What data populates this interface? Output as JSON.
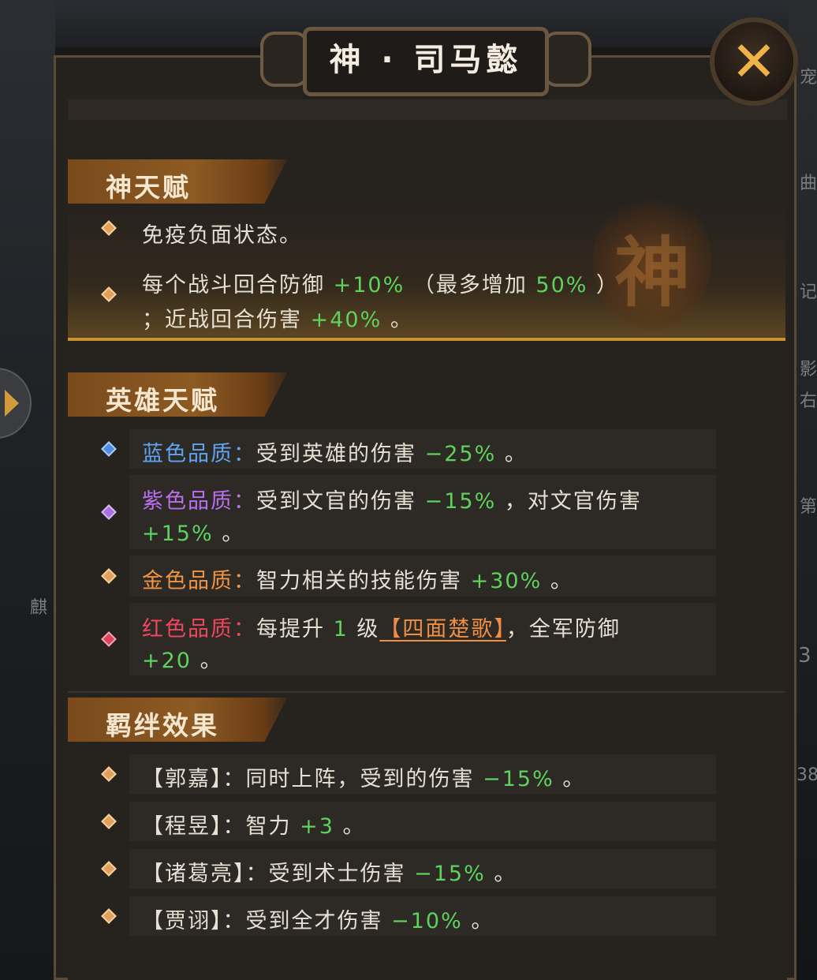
{
  "window": {
    "title": "神 · 司马懿"
  },
  "close": {
    "glyph": "✕"
  },
  "side": {
    "snippets": [
      "宠",
      "曲",
      "记",
      "影",
      "右",
      "第",
      "3",
      "38",
      "麒"
    ]
  },
  "sections": {
    "god_talent": {
      "title": "神天赋",
      "emblem_char": "神",
      "line1": "免疫负面状态。",
      "line2_prefix": "每个战斗回合防御 ",
      "line2_value": "+10%",
      "line2_mid": " （最多增加 ",
      "line2_cap": "50%",
      "line2_end": " ）",
      "line3_prefix": "；近战回合伤害 ",
      "line3_value": "+40%",
      "line3_end": " 。"
    },
    "hero_talent": {
      "title": "英雄天赋",
      "blue_label": "蓝色品质：",
      "blue_text": "受到英雄的伤害 ",
      "blue_value": "−25%",
      "blue_end": " 。",
      "purple_label": "紫色品质：",
      "purple_text": "受到文官的伤害 ",
      "purple_value": "−15%",
      "purple_mid": " ，对文官伤害",
      "purple_value2": "+15%",
      "purple_end": " 。",
      "gold_label": "金色品质：",
      "gold_text": "智力相关的技能伤害 ",
      "gold_value": "+30%",
      "gold_end": " 。",
      "red_label": "红色品质：",
      "red_text": "每提升 ",
      "red_level": "1",
      "red_text2": " 级",
      "red_link": "【四面楚歌】",
      "red_mid": "，全军防御",
      "red_value": "+20",
      "red_end": " 。"
    },
    "bond": {
      "title": "羁绊效果",
      "rows": [
        {
          "name": "【郭嘉】",
          "text": "：同时上阵，受到的伤害 ",
          "value": "−15%",
          "end": " 。"
        },
        {
          "name": "【程昱】",
          "text": "：智力 ",
          "value": "+3",
          "end": " 。"
        },
        {
          "name": "【诸葛亮】",
          "text": "：受到术士伤害 ",
          "value": "−15%",
          "end": " 。"
        },
        {
          "name": "【贾诩】",
          "text": "：受到全才伤害 ",
          "value": "−10%",
          "end": " 。"
        }
      ]
    }
  },
  "colors": {
    "accent_gold": "#f0b34a",
    "value_green": "#5dd25d",
    "quality_blue": "#5ea4f0",
    "quality_purple": "#b96ff0",
    "quality_gold": "#ef9543",
    "quality_red": "#f0475e"
  },
  "icons": [
    "close-icon",
    "arrow-right-icon",
    "diamond-bullet-icon",
    "god-emblem-icon"
  ]
}
